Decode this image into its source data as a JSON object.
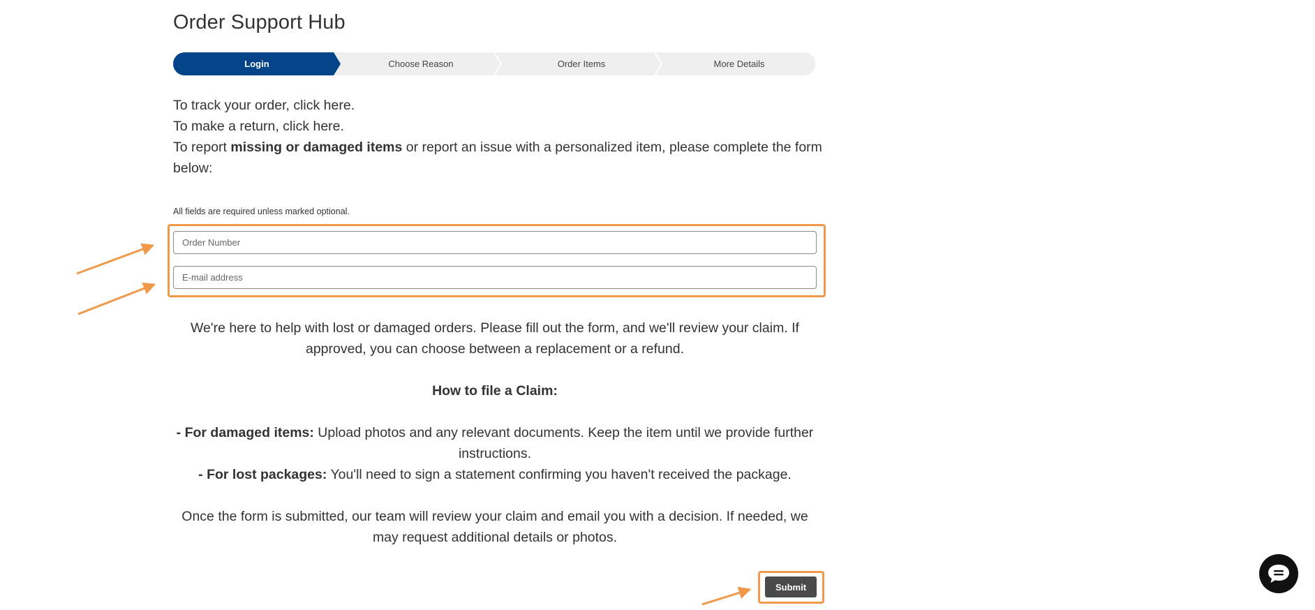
{
  "page": {
    "title": "Order Support Hub"
  },
  "stepper": {
    "steps": [
      {
        "label": "Login",
        "active": true
      },
      {
        "label": "Choose Reason",
        "active": false
      },
      {
        "label": "Order Items",
        "active": false
      },
      {
        "label": "More Details",
        "active": false
      }
    ],
    "active_color": "#034389",
    "inactive_color": "#efefef"
  },
  "intro": {
    "track_prefix": "To track your order, click ",
    "track_link": "here",
    "track_suffix": ".",
    "return_prefix": "To make a return, click ",
    "return_link": "here",
    "return_suffix": ".",
    "report_prefix": "To report ",
    "report_bold": "missing or damaged items",
    "report_suffix": " or report an issue with a personalized item, please complete the form below:"
  },
  "form": {
    "required_note": "All fields are required unless marked optional.",
    "order_number_placeholder": "Order Number",
    "order_number_value": "",
    "email_placeholder": "E-mail address",
    "email_value": "",
    "submit_label": "Submit"
  },
  "info": {
    "help_text": "We're here to help with lost or damaged orders. Please fill out the form, and we'll review your claim. If approved, you can choose between a replacement or a refund.",
    "claim_heading": "How to file a Claim:",
    "damaged_label": "- For damaged items:",
    "damaged_text": " Upload photos and any relevant documents. Keep the item until we provide further instructions.",
    "lost_label": "- For lost packages:",
    "lost_text": " You'll need to sign a statement confirming you haven't received the package.",
    "closing_text": "Once the form is submitted, our team will review your claim and email you with a decision. If needed, we may request additional details or photos."
  },
  "annotations": {
    "highlight_color": "#f0994a"
  },
  "chat": {
    "icon": "chat-bubble-icon"
  }
}
